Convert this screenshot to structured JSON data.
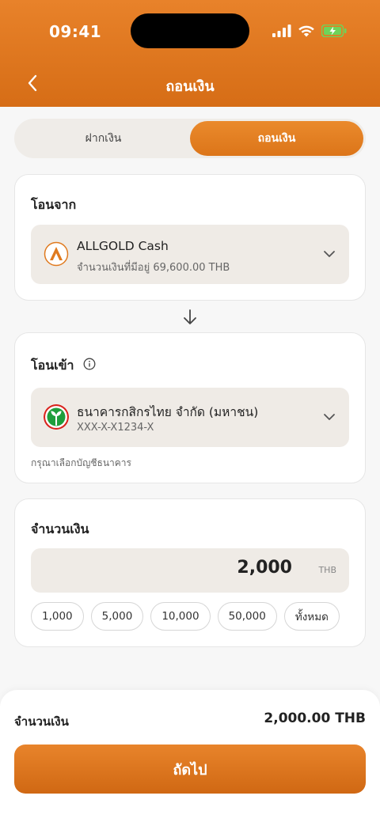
{
  "status_bar": {
    "time": "09:41"
  },
  "nav": {
    "title": "ถอนเงิน"
  },
  "tabs": [
    {
      "label": "ฝากเงิน",
      "active": false
    },
    {
      "label": "ถอนเงิน",
      "active": true
    }
  ],
  "transfer_from": {
    "title": "โอนจาก",
    "account_name": "ALLGOLD Cash",
    "balance_text": "จำนวนเงินที่มีอยู่ 69,600.00 THB"
  },
  "transfer_to": {
    "title": "โอนเข้า",
    "bank_name": "ธนาคารกสิกรไทย จำกัด (มหาชน)",
    "account_number": "XXX-X-X1234-X",
    "hint": "กรุณาเลือกบัญชีธนาคาร"
  },
  "amount": {
    "title": "จำนวนเงิน",
    "value": "2,000",
    "unit": "THB",
    "quick_amounts": [
      "1,000",
      "5,000",
      "10,000",
      "50,000",
      "ทั้งหมด"
    ]
  },
  "summary": {
    "label": "จำนวนเงิน",
    "value": "2,000.00 THB",
    "button_label": "ถัดไป"
  },
  "colors": {
    "accent": "#e07a1f",
    "kbank_green": "#1e9e3c",
    "battery": "#6fd35a"
  },
  "icons": [
    "signal-icon",
    "wifi-icon",
    "battery-icon",
    "back-icon",
    "allgold-logo-icon",
    "chevron-down-icon",
    "arrow-down-icon",
    "info-icon",
    "kbank-logo-icon"
  ]
}
